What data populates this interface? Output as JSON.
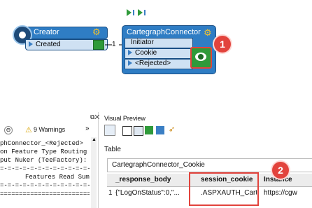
{
  "canvas": {
    "creator": {
      "title": "Creator",
      "port": "Created"
    },
    "connector_label": "1",
    "cartegraph": {
      "title": "CartegraphConnector",
      "ports": [
        "Initiator",
        "Cookie",
        "<Rejected>"
      ]
    },
    "badge1": "1"
  },
  "log_panel": {
    "warnings": "9 Warnings",
    "lines": [
      "phConnector_<Rejected>",
      "on Feature Type Routing C",
      "put Nuker (TeeFactory): Cl",
      "=-=-=-=-=-=-=-=-=-=-=-=-=-",
      "Features Read Sum",
      "=-=-=-=-=-=-=-=-=-=-=-=-=-",
      "==========================="
    ]
  },
  "preview": {
    "title": "Visual Preview",
    "section": "Table",
    "table_name": "CartegraphConnector_Cookie",
    "columns": [
      "_response_body",
      "session_cookie",
      "Instance"
    ],
    "rows": [
      {
        "num": "1",
        "cells": [
          "{\"LogOnStatus\":0,\"...",
          ".ASPXAUTH_Carte...",
          "https://cgw"
        ]
      }
    ],
    "badge2": "2"
  }
}
